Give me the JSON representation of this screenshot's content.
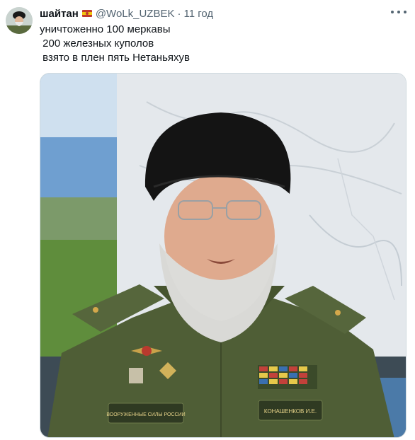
{
  "tweet": {
    "display_name": "шайтан",
    "name_emoji": "flag-emoji-icon",
    "handle": "@WoLk_UZBEK",
    "separator": "·",
    "time": "11 год",
    "text_lines": [
      "уничтоженно 100 меркавы",
      " 200 железных куполов",
      " взято в плен пять Нетаньяхув"
    ],
    "media": {
      "uniform_patch_left": "ВООРУЖЕННЫЕ СИЛЫ РОССИИ",
      "uniform_patch_right": "КОНАШЕНКОВ И.Е."
    }
  },
  "colors": {
    "text_primary": "#0f1419",
    "text_secondary": "#536471",
    "border": "#cfd9de",
    "uniform_green": "#4f5e36"
  }
}
